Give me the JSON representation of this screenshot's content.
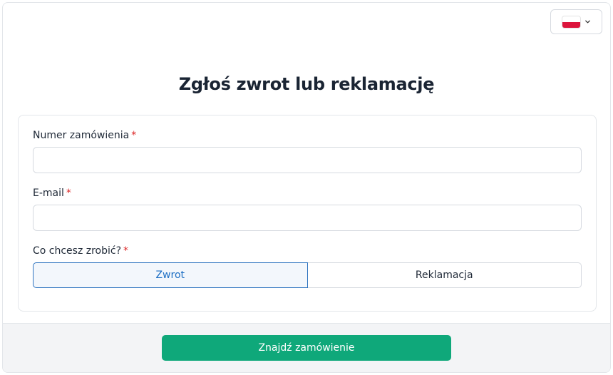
{
  "language_selector": {
    "flag": "poland-flag",
    "icon": "chevron-down-icon"
  },
  "page": {
    "title": "Zgłoś zwrot lub reklamację"
  },
  "form": {
    "required_marker": "*",
    "order_number": {
      "label": "Numer zamówienia",
      "value": "",
      "placeholder": ""
    },
    "email": {
      "label": "E-mail",
      "value": "",
      "placeholder": ""
    },
    "action": {
      "label": "Co chcesz zrobić?",
      "options": [
        "Zwrot",
        "Reklamacja"
      ],
      "selected": "Zwrot"
    }
  },
  "footer": {
    "submit_label": "Znajdź zamówienie"
  },
  "colors": {
    "accent": "#0fa87a",
    "selected_border": "#2f74c0",
    "selected_text": "#1d6fc4",
    "required": "#dc2626",
    "flag_red": "#dc143c"
  }
}
